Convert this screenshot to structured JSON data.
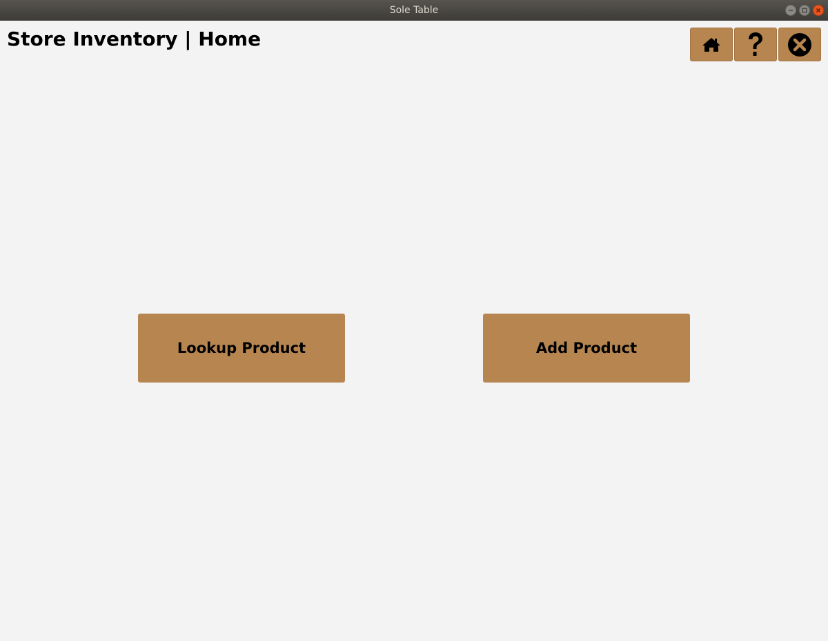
{
  "window": {
    "title": "Sole Table"
  },
  "header": {
    "title": "Store Inventory | Home"
  },
  "toolbar": {
    "home_icon": "home-icon",
    "help_icon": "question-mark-icon",
    "close_icon": "close-circle-icon"
  },
  "main": {
    "lookup_label": "Lookup Product",
    "add_label": "Add Product"
  },
  "colors": {
    "accent": "#b78650",
    "background": "#f3f3f3",
    "titlebar": "#3d3b37"
  }
}
